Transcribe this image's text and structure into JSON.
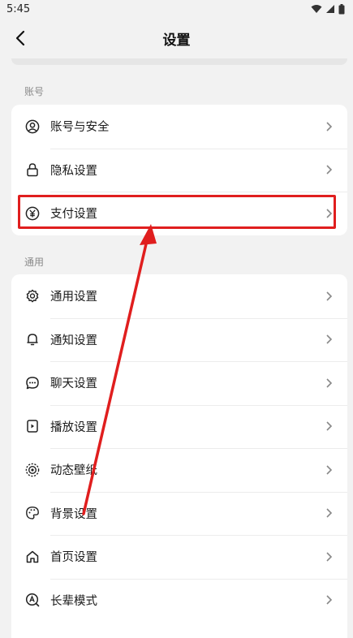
{
  "status_bar": {
    "time": "5:45"
  },
  "header": {
    "title": "设置"
  },
  "sections": [
    {
      "label": "账号",
      "items": [
        {
          "label": "账号与安全",
          "icon": "user-circle-icon"
        },
        {
          "label": "隐私设置",
          "icon": "lock-icon"
        },
        {
          "label": "支付设置",
          "icon": "yuan-icon"
        }
      ]
    },
    {
      "label": "通用",
      "items": [
        {
          "label": "通用设置",
          "icon": "gear-icon"
        },
        {
          "label": "通知设置",
          "icon": "bell-icon"
        },
        {
          "label": "聊天设置",
          "icon": "chat-bubble-icon"
        },
        {
          "label": "播放设置",
          "icon": "play-device-icon"
        },
        {
          "label": "动态壁纸",
          "icon": "dynamic-wallpaper-icon"
        },
        {
          "label": "背景设置",
          "icon": "palette-icon"
        },
        {
          "label": "首页设置",
          "icon": "home-icon"
        },
        {
          "label": "长辈模式",
          "icon": "elder-mode-icon"
        }
      ]
    }
  ],
  "colors": {
    "annotation": "#e01e1e",
    "background": "#f2f2f2",
    "card": "#ffffff"
  }
}
